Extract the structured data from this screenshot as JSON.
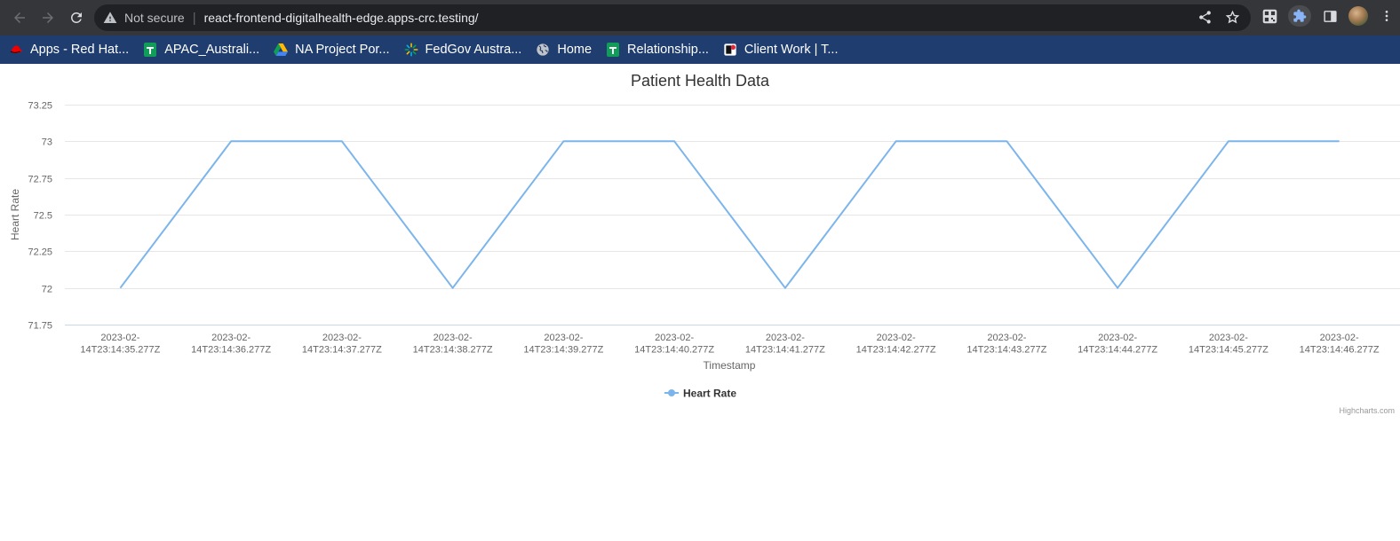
{
  "browser": {
    "security_label": "Not secure",
    "url": "react-frontend-digitalhealth-edge.apps-crc.testing/",
    "bookmarks": [
      {
        "label": "Apps - Red Hat...",
        "icon": "redhat-icon"
      },
      {
        "label": "APAC_Australi...",
        "icon": "sheets-icon"
      },
      {
        "label": "NA Project Por...",
        "icon": "drive-icon"
      },
      {
        "label": "FedGov Austra...",
        "icon": "spark-icon"
      },
      {
        "label": "Home",
        "icon": "globe-icon"
      },
      {
        "label": "Relationship...",
        "icon": "sheets-icon"
      },
      {
        "label": "Client Work | T...",
        "icon": "app-icon"
      }
    ]
  },
  "chart_data": {
    "type": "line",
    "title": "Patient Health Data",
    "xlabel": "Timestamp",
    "ylabel": "Heart Rate",
    "categories": [
      "2023-02-14T23:14:35.277Z",
      "2023-02-14T23:14:36.277Z",
      "2023-02-14T23:14:37.277Z",
      "2023-02-14T23:14:38.277Z",
      "2023-02-14T23:14:39.277Z",
      "2023-02-14T23:14:40.277Z",
      "2023-02-14T23:14:41.277Z",
      "2023-02-14T23:14:42.277Z",
      "2023-02-14T23:14:43.277Z",
      "2023-02-14T23:14:44.277Z",
      "2023-02-14T23:14:45.277Z",
      "2023-02-14T23:14:46.277Z"
    ],
    "category_lines": [
      [
        "2023-02-",
        "14T23:14:35.277Z"
      ],
      [
        "2023-02-",
        "14T23:14:36.277Z"
      ],
      [
        "2023-02-",
        "14T23:14:37.277Z"
      ],
      [
        "2023-02-",
        "14T23:14:38.277Z"
      ],
      [
        "2023-02-",
        "14T23:14:39.277Z"
      ],
      [
        "2023-02-",
        "14T23:14:40.277Z"
      ],
      [
        "2023-02-",
        "14T23:14:41.277Z"
      ],
      [
        "2023-02-",
        "14T23:14:42.277Z"
      ],
      [
        "2023-02-",
        "14T23:14:43.277Z"
      ],
      [
        "2023-02-",
        "14T23:14:44.277Z"
      ],
      [
        "2023-02-",
        "14T23:14:45.277Z"
      ],
      [
        "2023-02-",
        "14T23:14:46.277Z"
      ]
    ],
    "series": [
      {
        "name": "Heart Rate",
        "color": "#7cb5ec",
        "values": [
          72,
          73,
          73,
          72,
          73,
          73,
          72,
          73,
          73,
          72,
          73,
          73
        ]
      }
    ],
    "ylim": [
      71.75,
      73.25
    ],
    "yticks": [
      71.75,
      72,
      72.25,
      72.5,
      72.75,
      73,
      73.25
    ],
    "ytick_labels": [
      "71.75",
      "72",
      "72.25",
      "72.5",
      "72.75",
      "73",
      "73.25"
    ],
    "grid": true,
    "legend": "bottom-center",
    "credits": "Highcharts.com"
  }
}
